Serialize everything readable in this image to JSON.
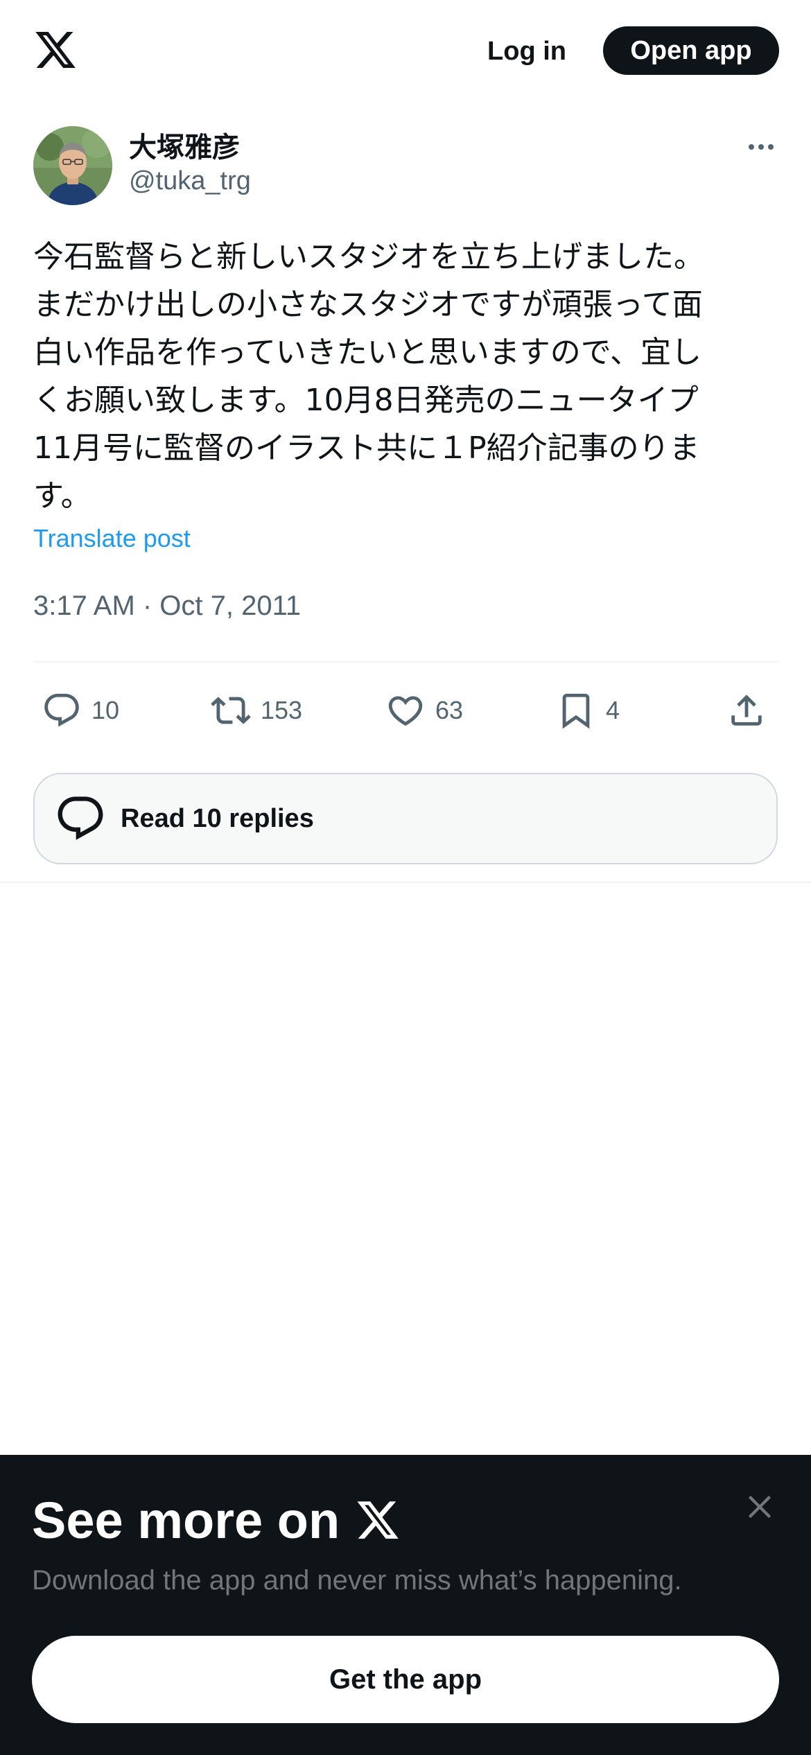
{
  "header": {
    "logo_icon": "x-logo-icon",
    "login_label": "Log in",
    "open_app_label": "Open app"
  },
  "tweet": {
    "author_name": "大塚雅彦",
    "author_handle": "@tuka_trg",
    "text": "今石監督らと新しいスタジオを立ち上げました。\nまだかけ出しの小さなスタジオですが頑張って面\n白い作品を作っていきたいと思いますので、宜し\nくお願い致します。10月8日発売のニュータイプ\n11月号に監督のイラスト共に１P紹介記事のりま\nす。",
    "translate_label": "Translate post",
    "timestamp": "3:17 AM · Oct 7, 2011",
    "stats": {
      "replies": "10",
      "reposts": "153",
      "likes": "63",
      "bookmarks": "4"
    },
    "read_replies_label": "Read 10 replies"
  },
  "bottom_sheet": {
    "title": "See more on",
    "subtitle": "Download the app and never miss what’s happening.",
    "cta_label": "Get the app"
  },
  "colors": {
    "text_primary": "#0f1419",
    "text_secondary": "#536471",
    "link": "#1d9bf0",
    "sheet_bg": "#0f1419"
  }
}
